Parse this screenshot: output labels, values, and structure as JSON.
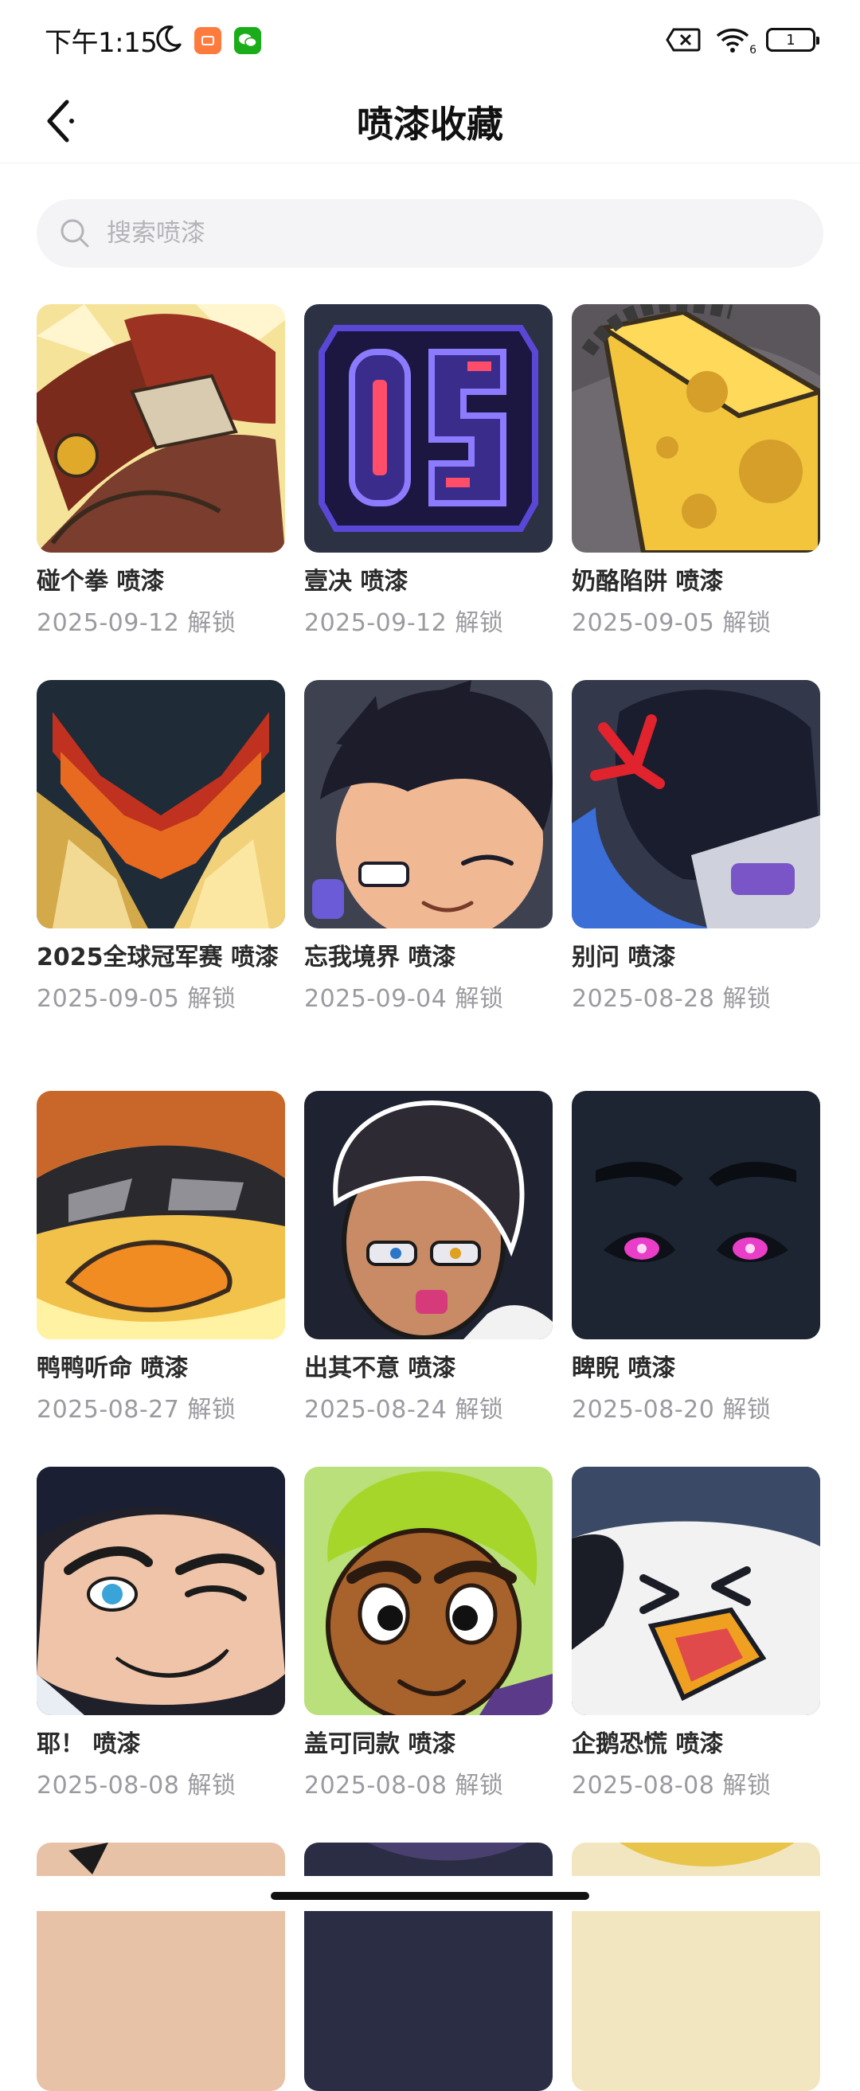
{
  "status_bar": {
    "time": "下午1:15",
    "battery_level": "1",
    "signal_badge": "6"
  },
  "nav": {
    "title": "喷漆收藏"
  },
  "search": {
    "placeholder": "搜索喷漆",
    "value": ""
  },
  "sprays": [
    {
      "name": "碰个拳 喷漆",
      "date": "2025-09-12 解锁"
    },
    {
      "name": "壹决 喷漆",
      "date": "2025-09-12 解锁"
    },
    {
      "name": "奶酪陷阱 喷漆",
      "date": "2025-09-05 解锁"
    },
    {
      "name": "2025全球冠军赛 喷漆",
      "date": "2025-09-05 解锁"
    },
    {
      "name": "忘我境界 喷漆",
      "date": "2025-09-04 解锁"
    },
    {
      "name": "别问 喷漆",
      "date": "2025-08-28 解锁"
    },
    {
      "name": "鸭鸭听命 喷漆",
      "date": "2025-08-27 解锁"
    },
    {
      "name": "出其不意 喷漆",
      "date": "2025-08-24 解锁"
    },
    {
      "name": "睥睨 喷漆",
      "date": "2025-08-20 解锁"
    },
    {
      "name": "耶！ 喷漆",
      "date": "2025-08-08 解锁"
    },
    {
      "name": "盖可同款 喷漆",
      "date": "2025-08-08 解锁"
    },
    {
      "name": "企鹅恐慌 喷漆",
      "date": "2025-08-08 解锁"
    }
  ],
  "colors": {
    "accent_text": "#111111",
    "secondary_text": "#9a9aa0",
    "search_bg": "#f4f4f6"
  }
}
